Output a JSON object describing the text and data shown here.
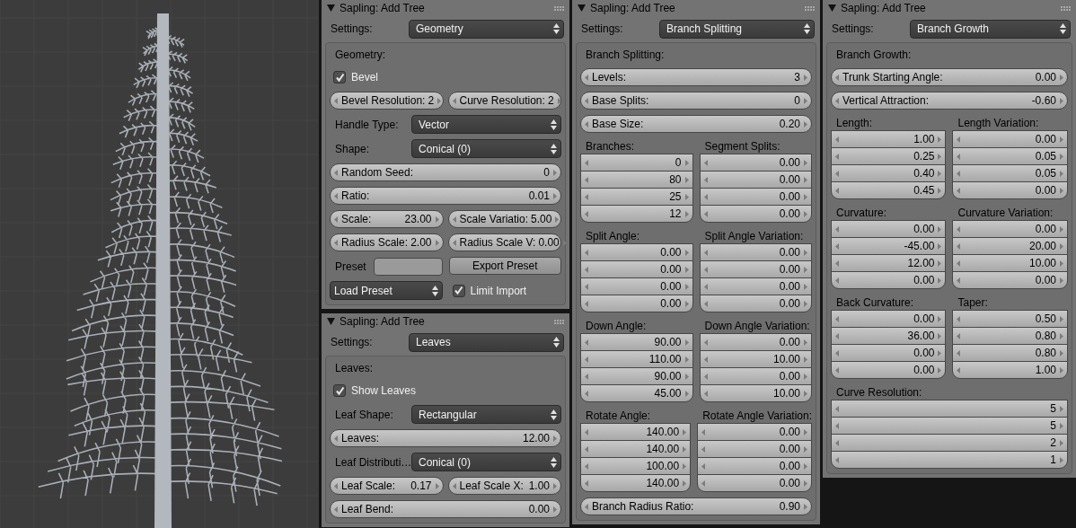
{
  "viewport": {
    "kind": "tree"
  },
  "columns": [
    {
      "panels": [
        {
          "title": "Sapling: Add Tree",
          "settings": {
            "label": "Settings:",
            "value": "Geometry"
          },
          "rows": [
            {
              "kind": "heading",
              "text": "Geometry:"
            },
            {
              "kind": "checkbox",
              "label": "Bevel",
              "checked": true
            },
            {
              "kind": "pair",
              "fields": [
                {
                  "label": "Bevel Resolution:",
                  "value": "2"
                },
                {
                  "label": "Curve Resolution:",
                  "value": "2"
                }
              ]
            },
            {
              "kind": "select",
              "label": "Handle Type:",
              "value": "Vector"
            },
            {
              "kind": "select",
              "label": "Shape:",
              "value": "Conical (0)"
            },
            {
              "kind": "field",
              "label": "Random Seed:",
              "value": "0"
            },
            {
              "kind": "field",
              "label": "Ratio:",
              "value": "0.01"
            },
            {
              "kind": "pair",
              "fields": [
                {
                  "label": "Scale:",
                  "value": "23.00"
                },
                {
                  "label": "Scale Variatio:",
                  "value": "5.00"
                }
              ]
            },
            {
              "kind": "pair",
              "fields": [
                {
                  "label": "Radius Scale:",
                  "value": "2.00"
                },
                {
                  "label": "Radius Scale V:",
                  "value": "0.00"
                }
              ]
            },
            {
              "kind": "preset",
              "label": "Preset",
              "button": "Export Preset"
            },
            {
              "kind": "load",
              "dropdown": "Load Preset",
              "label": "Limit Import",
              "checked": true
            }
          ]
        },
        {
          "title": "Sapling: Add Tree",
          "settings": {
            "label": "Settings:",
            "value": "Leaves"
          },
          "rows": [
            {
              "kind": "heading",
              "text": "Leaves:"
            },
            {
              "kind": "checkbox",
              "label": "Show Leaves",
              "checked": true
            },
            {
              "kind": "select",
              "label": "Leaf Shape:",
              "value": "Rectangular"
            },
            {
              "kind": "field",
              "label": "Leaves:",
              "value": "12.00"
            },
            {
              "kind": "select",
              "label": "Leaf Distributi…",
              "value": "Conical (0)"
            },
            {
              "kind": "pair",
              "fields": [
                {
                  "label": "Leaf Scale:",
                  "value": "0.17"
                },
                {
                  "label": "Leaf Scale X:",
                  "value": "1.00"
                }
              ]
            },
            {
              "kind": "field",
              "label": "Leaf Bend:",
              "value": "0.00"
            }
          ]
        }
      ]
    },
    {
      "panels": [
        {
          "title": "Sapling: Add Tree",
          "settings": {
            "label": "Settings:",
            "value": "Branch Splitting"
          },
          "rows": [
            {
              "kind": "heading",
              "text": "Branch Splitting:"
            },
            {
              "kind": "field",
              "label": "Levels:",
              "value": "3"
            },
            {
              "kind": "field",
              "label": "Base Splits:",
              "value": "0"
            },
            {
              "kind": "field",
              "label": "Base Size:",
              "value": "0.20"
            },
            {
              "kind": "columns",
              "columns": [
                {
                  "heading": "Branches:",
                  "values": [
                    "0",
                    "80",
                    "25",
                    "12"
                  ]
                },
                {
                  "heading": "Segment Splits:",
                  "values": [
                    "0.00",
                    "0.00",
                    "0.00",
                    "0.00"
                  ]
                }
              ]
            },
            {
              "kind": "columns",
              "columns": [
                {
                  "heading": "Split Angle:",
                  "values": [
                    "0.00",
                    "0.00",
                    "0.00",
                    "0.00"
                  ]
                },
                {
                  "heading": "Split Angle Variation:",
                  "values": [
                    "0.00",
                    "0.00",
                    "0.00",
                    "0.00"
                  ]
                }
              ]
            },
            {
              "kind": "columns",
              "columns": [
                {
                  "heading": "Down Angle:",
                  "values": [
                    "90.00",
                    "110.00",
                    "90.00",
                    "45.00"
                  ]
                },
                {
                  "heading": "Down Angle Variation:",
                  "values": [
                    "0.00",
                    "10.00",
                    "0.00",
                    "10.00"
                  ]
                }
              ]
            },
            {
              "kind": "columns",
              "columns": [
                {
                  "heading": "Rotate Angle:",
                  "values": [
                    "140.00",
                    "140.00",
                    "100.00",
                    "140.00"
                  ]
                },
                {
                  "heading": "Rotate Angle Variation:",
                  "values": [
                    "0.00",
                    "0.00",
                    "0.00",
                    "0.00"
                  ]
                }
              ]
            },
            {
              "kind": "field",
              "label": "Branch Radius Ratio:",
              "value": "0.90"
            }
          ]
        }
      ]
    },
    {
      "panels": [
        {
          "title": "Sapling: Add Tree",
          "settings": {
            "label": "Settings:",
            "value": "Branch Growth"
          },
          "rows": [
            {
              "kind": "heading",
              "text": "Branch Growth:"
            },
            {
              "kind": "field",
              "label": "Trunk Starting Angle:",
              "value": "0.00"
            },
            {
              "kind": "field",
              "label": "Vertical Attraction:",
              "value": "-0.60"
            },
            {
              "kind": "columns",
              "columns": [
                {
                  "heading": "Length:",
                  "values": [
                    "1.00",
                    "0.25",
                    "0.40",
                    "0.45"
                  ]
                },
                {
                  "heading": "Length Variation:",
                  "values": [
                    "0.00",
                    "0.05",
                    "0.05",
                    "0.00"
                  ]
                }
              ]
            },
            {
              "kind": "columns",
              "columns": [
                {
                  "heading": "Curvature:",
                  "values": [
                    "0.00",
                    "-45.00",
                    "12.00",
                    "0.00"
                  ]
                },
                {
                  "heading": "Curvature Variation:",
                  "values": [
                    "0.00",
                    "20.00",
                    "10.00",
                    "0.00"
                  ]
                }
              ]
            },
            {
              "kind": "columns",
              "columns": [
                {
                  "heading": "Back Curvature:",
                  "values": [
                    "0.00",
                    "36.00",
                    "0.00",
                    "0.00"
                  ]
                },
                {
                  "heading": "Taper:",
                  "values": [
                    "0.50",
                    "0.80",
                    "0.80",
                    "1.00"
                  ]
                }
              ]
            },
            {
              "kind": "columns",
              "columns": [
                {
                  "heading": "Curve Resolution:",
                  "values": [
                    "5",
                    "5",
                    "2",
                    "1"
                  ]
                }
              ]
            }
          ]
        }
      ]
    }
  ]
}
